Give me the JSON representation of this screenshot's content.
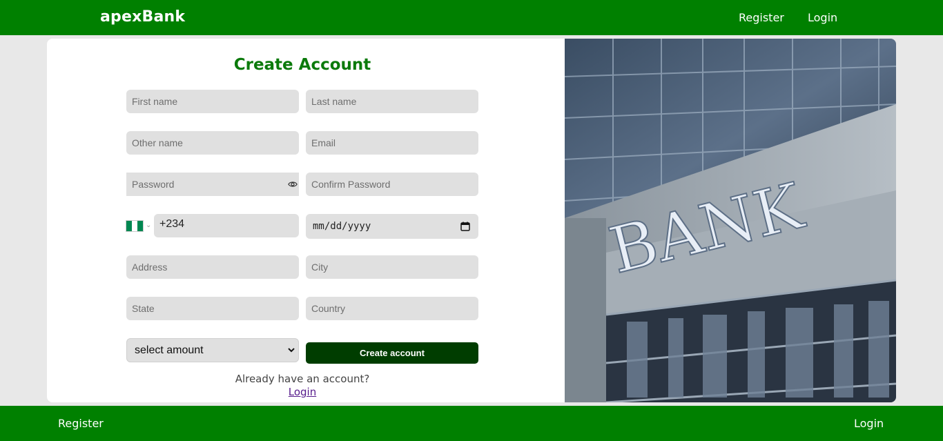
{
  "header": {
    "brand": "apexBank",
    "nav": {
      "register": "Register",
      "login": "Login"
    }
  },
  "form": {
    "title": "Create Account",
    "fields": {
      "first_name": "First name",
      "last_name": "Last name",
      "other_name": "Other name",
      "email": "Email",
      "password": "Password",
      "confirm_password": "Confirm Password",
      "phone": "+234",
      "date": "mm/dd/yyyy",
      "address": "Address",
      "city": "City",
      "state": "State",
      "country": "Country"
    },
    "amount_select": "select amount",
    "submit_label": "Create account",
    "already_text": "Already have an account?",
    "login_link": "Login"
  },
  "image": {
    "sign_text": "BANK"
  },
  "footer": {
    "register": "Register",
    "login": "Login"
  },
  "colors": {
    "primary": "#008000",
    "button": "#003d00",
    "title": "#0b7a0b"
  }
}
